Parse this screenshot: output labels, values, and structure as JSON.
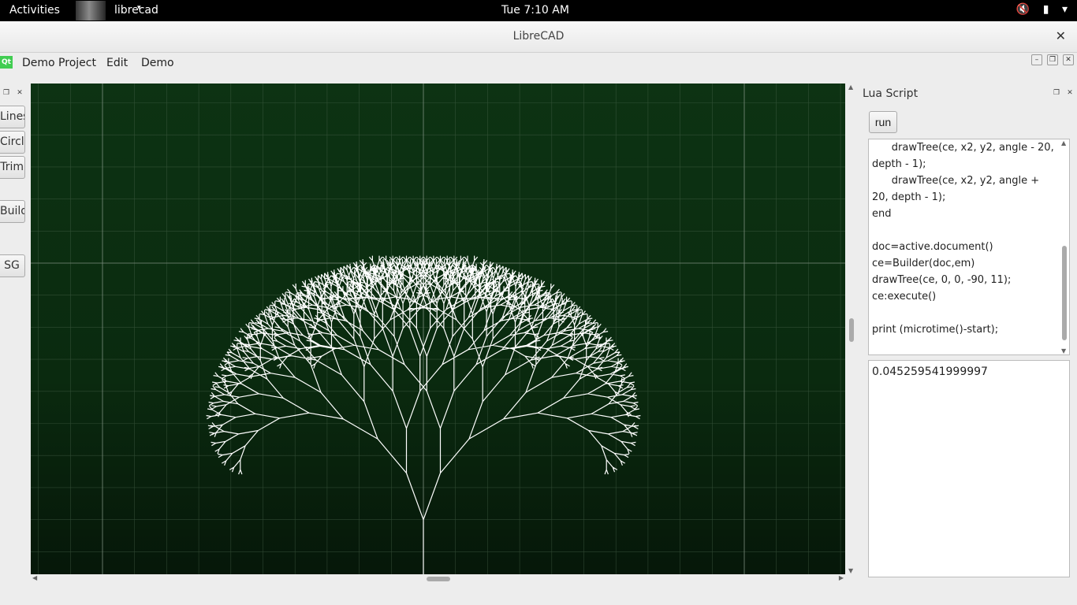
{
  "topbar": {
    "activities": "Activities",
    "app_name": "librecad",
    "app_caret": "▾",
    "clock": "Tue  7:10 AM",
    "volume_icon": "🔇",
    "battery_icon": "▮",
    "menu_caret": "▾"
  },
  "window": {
    "title": "LibreCAD",
    "close": "✕"
  },
  "menubar": {
    "logo": "Qt",
    "items": [
      "Demo Project",
      "Edit",
      "Demo"
    ],
    "mdi": {
      "minimize": "–",
      "restore": "❐",
      "close": "✕"
    }
  },
  "left_toolbar": {
    "float": "❐",
    "close": "✕",
    "buttons": [
      "Lines",
      "Circle",
      "Trim",
      "Builder",
      "SG"
    ]
  },
  "lua_dock": {
    "title": "Lua Script",
    "float": "❐",
    "close": "✕",
    "run_label": "run",
    "script": "      drawTree(ce, x2, y2, angle - 20, depth - 1);\n      drawTree(ce, x2, y2, angle + 20, depth - 1);\nend\n\ndoc=active.document()\nce=Builder(doc,em)\ndrawTree(ce, 0, 0, -90, 11);\nce:execute()\n\nprint (microtime()-start);",
    "output": "0.045259541999997"
  },
  "drawing": {
    "background": "#0a2a0f",
    "line_color": "#ffffff",
    "grid_color": "#4f6a52",
    "tree": {
      "start_angle": -90,
      "depth": 11,
      "branch_angle": 20
    }
  }
}
